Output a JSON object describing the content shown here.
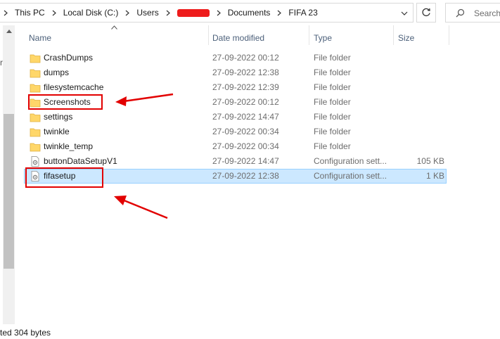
{
  "address_bar": {
    "crumbs": [
      "This PC",
      "Local Disk (C:)",
      "Users",
      "Documents",
      "FIFA 23"
    ],
    "redacted_segment_color": "#ee1c1c"
  },
  "search": {
    "placeholder": "Search"
  },
  "columns": {
    "name": "Name",
    "date": "Date modified",
    "type": "Type",
    "size": "Size"
  },
  "files": [
    {
      "name": "CrashDumps",
      "date": "27-09-2022 00:12",
      "type": "File folder",
      "size": "",
      "icon": "folder-icon"
    },
    {
      "name": "dumps",
      "date": "27-09-2022 12:38",
      "type": "File folder",
      "size": "",
      "icon": "folder-icon"
    },
    {
      "name": "filesystemcache",
      "date": "27-09-2022 12:39",
      "type": "File folder",
      "size": "",
      "icon": "folder-icon"
    },
    {
      "name": "Screenshots",
      "date": "27-09-2022 00:12",
      "type": "File folder",
      "size": "",
      "icon": "folder-icon"
    },
    {
      "name": "settings",
      "date": "27-09-2022 14:47",
      "type": "File folder",
      "size": "",
      "icon": "folder-icon"
    },
    {
      "name": "twinkle",
      "date": "27-09-2022 00:34",
      "type": "File folder",
      "size": "",
      "icon": "folder-icon"
    },
    {
      "name": "twinkle_temp",
      "date": "27-09-2022 00:34",
      "type": "File folder",
      "size": "",
      "icon": "folder-icon"
    },
    {
      "name": "buttonDataSetupV1",
      "date": "27-09-2022 14:47",
      "type": "Configuration sett...",
      "size": "105 KB",
      "icon": "config-file-icon"
    },
    {
      "name": "fifasetup",
      "date": "27-09-2022 12:38",
      "type": "Configuration sett...",
      "size": "1 KB",
      "icon": "config-file-icon",
      "selected": true
    }
  ],
  "status_bar": {
    "text": "ted  304 bytes"
  },
  "colors": {
    "selection": "#cce8ff",
    "annotation": "#e20000",
    "folder": "#ffd769"
  }
}
